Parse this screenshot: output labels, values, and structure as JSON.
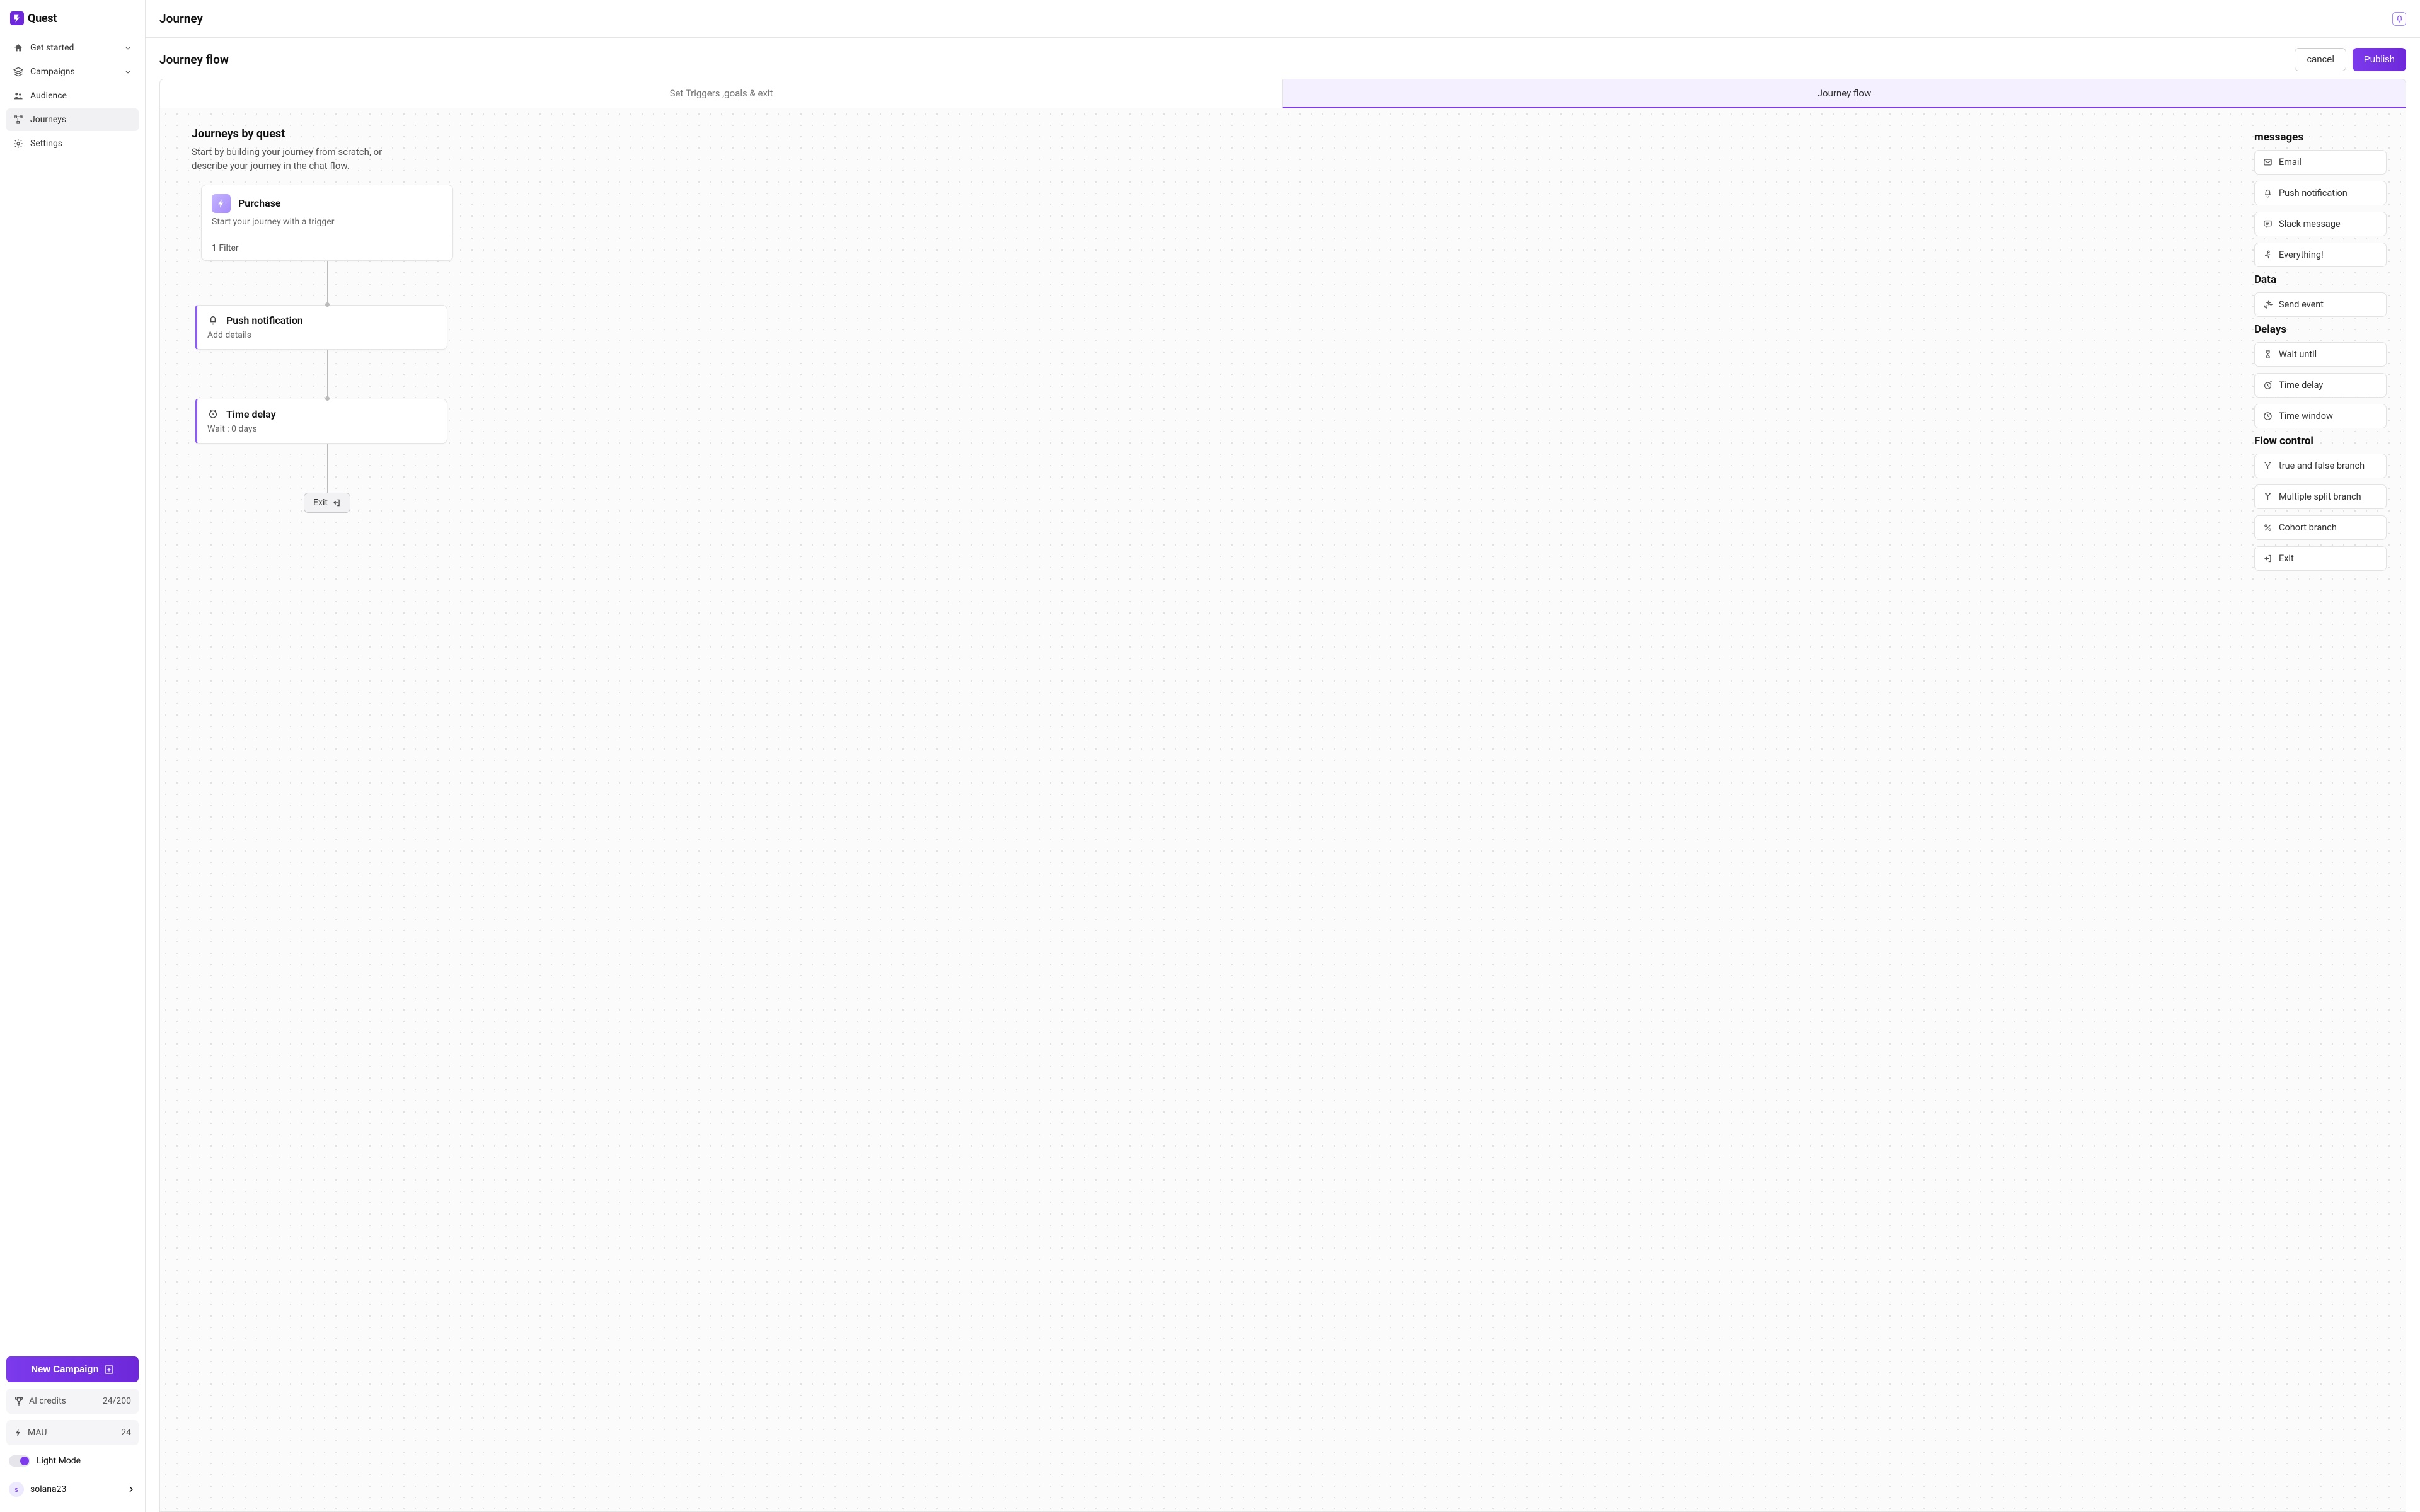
{
  "brand": {
    "name": "Quest"
  },
  "sidebar": {
    "items": [
      {
        "label": "Get started",
        "icon": "home",
        "expandable": true
      },
      {
        "label": "Campaigns",
        "icon": "layers",
        "expandable": true
      },
      {
        "label": "Audience",
        "icon": "people",
        "expandable": false
      },
      {
        "label": "Journeys",
        "icon": "flow",
        "expandable": false,
        "active": true
      },
      {
        "label": "Settings",
        "icon": "gear",
        "expandable": false
      }
    ],
    "new_campaign_label": "New Campaign",
    "ai_credits": {
      "label": "AI credits",
      "value": "24/200"
    },
    "mau": {
      "label": "MAU",
      "value": "24"
    },
    "theme_label": "Light Mode",
    "user": {
      "name": "solana23",
      "initial": "s"
    }
  },
  "header": {
    "title": "Journey"
  },
  "subheader": {
    "title": "Journey flow",
    "cancel_label": "cancel",
    "publish_label": "Publish"
  },
  "tabs": [
    {
      "label": "Set Triggers ,goals & exit",
      "active": false
    },
    {
      "label": "Journey flow",
      "active": true
    }
  ],
  "canvas": {
    "heading": "Journeys by quest",
    "desc": "Start by building your journey from scratch, or describe your  journey in the chat flow.",
    "nodes": {
      "trigger": {
        "title": "Purchase",
        "sub": "Start your journey with a trigger",
        "footer": "1 Filter"
      },
      "push": {
        "title": "Push notification",
        "sub": "Add details"
      },
      "delay": {
        "title": "Time delay",
        "sub": "Wait : 0 days"
      },
      "exit": {
        "label": "Exit"
      }
    }
  },
  "palette": {
    "groups": [
      {
        "title": "messages",
        "items": [
          {
            "label": "Email",
            "icon": "mail"
          },
          {
            "label": "Push notification",
            "icon": "bell"
          },
          {
            "label": "Slack message",
            "icon": "chat"
          },
          {
            "label": "Everything!",
            "icon": "run"
          }
        ]
      },
      {
        "title": "Data",
        "items": [
          {
            "label": "Send event",
            "icon": "spark"
          }
        ]
      },
      {
        "title": "Delays",
        "items": [
          {
            "label": "Wait until",
            "icon": "hourglass"
          },
          {
            "label": "Time delay",
            "icon": "clockplus"
          },
          {
            "label": "Time window",
            "icon": "clockx"
          }
        ]
      },
      {
        "title": "Flow control",
        "items": [
          {
            "label": "true and false branch",
            "icon": "split2"
          },
          {
            "label": "Multiple split branch",
            "icon": "splitup"
          },
          {
            "label": "Cohort branch",
            "icon": "percent"
          },
          {
            "label": "Exit",
            "icon": "exit"
          }
        ]
      }
    ]
  }
}
